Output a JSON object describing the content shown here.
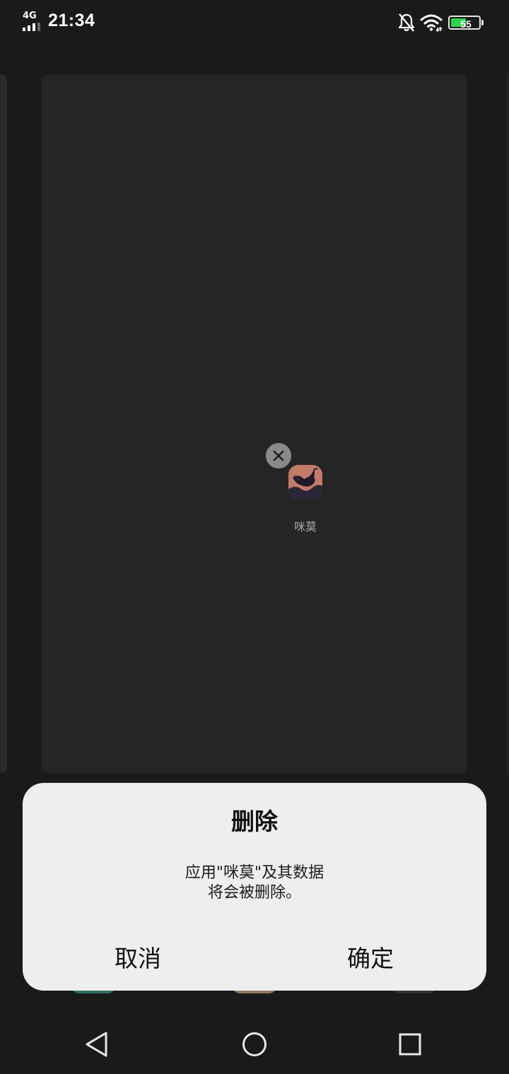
{
  "status_bar": {
    "network": "4G",
    "time": "21:34",
    "battery_level": "55",
    "battery_fraction": 0.55,
    "icons": [
      "signal-icon",
      "mute-bell-icon",
      "wifi-icon",
      "battery-icon"
    ]
  },
  "folder": {
    "apps": [
      {
        "label": "咪莫",
        "icon": "mimo-app-icon"
      }
    ]
  },
  "dialog": {
    "title": "删除",
    "message_line1": "应用\"咪莫\"及其数据",
    "message_line2": "将会被删除。",
    "cancel_label": "取消",
    "confirm_label": "确定"
  },
  "colors": {
    "background": "#1a1a1a",
    "folder_card": "#252525",
    "dialog_bg": "#eeeeee",
    "battery_green": "#2fd449"
  }
}
